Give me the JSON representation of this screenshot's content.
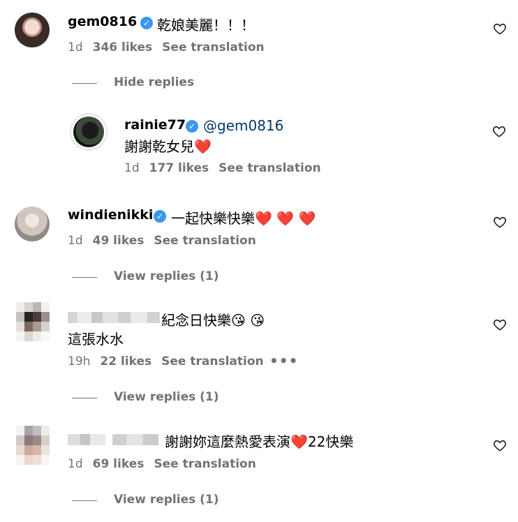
{
  "comments": [
    {
      "username": "gem0816",
      "text": "乾娘美麗！！！",
      "time": "1d",
      "likes": "346 likes",
      "translate": "See translation",
      "replies_toggle": "Hide replies"
    },
    {
      "username": "rainie77",
      "mention": "@gem0816",
      "text": "謝謝乾女兒",
      "emoji": "❤️",
      "time": "1d",
      "likes": "177 likes",
      "translate": "See translation"
    },
    {
      "username": "windienikki",
      "text": "一起快樂快樂",
      "emoji": "❤️ ❤️ ❤️",
      "time": "1d",
      "likes": "49 likes",
      "translate": "See translation",
      "replies_toggle": "View replies (1)"
    },
    {
      "text": "紀念日快樂",
      "emoji": "😘 😘",
      "text2": "這張水水",
      "time": "19h",
      "likes": "22 likes",
      "translate": "See translation",
      "more": "•••",
      "replies_toggle": "View replies (1)"
    },
    {
      "text": "謝謝妳這麼熱愛表演",
      "emoji": "❤️",
      "text_after": "22快樂",
      "time": "1d",
      "likes": "69 likes",
      "translate": "See translation",
      "replies_toggle": "View replies (1)"
    }
  ],
  "colors": {
    "meta": "#737373",
    "verified": "#3b97f0",
    "mention": "#00376b",
    "heart_red": "#e0202f"
  }
}
